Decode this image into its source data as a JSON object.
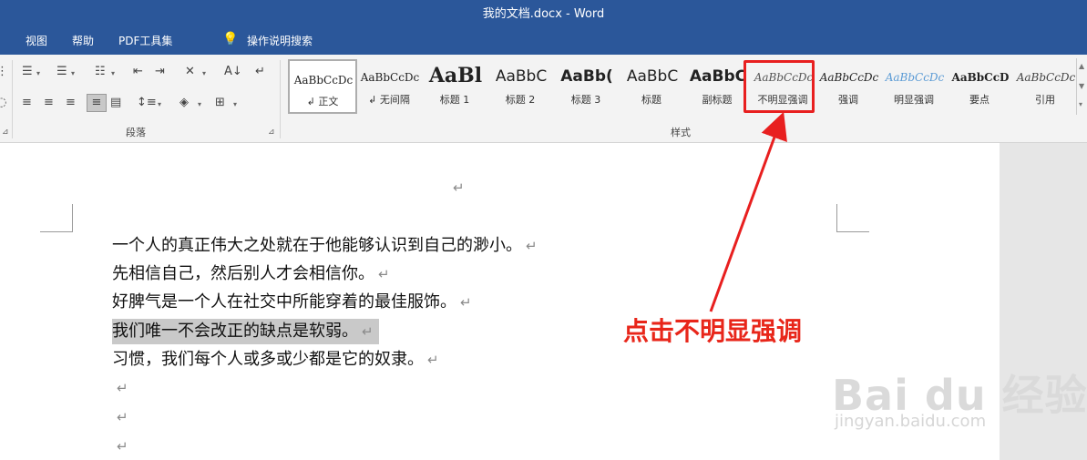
{
  "window": {
    "title": "我的文档.docx  -  Word"
  },
  "menu": {
    "items": [
      "视图",
      "帮助",
      "PDF工具集"
    ],
    "tell_me": "操作说明搜索"
  },
  "ribbon": {
    "paragraph_group_label": "段落",
    "styles_group_label": "样式",
    "styles": [
      {
        "sample": "AaBbCcDc",
        "name": "↲ 正文"
      },
      {
        "sample": "AaBbCcDc",
        "name": "↲ 无间隔"
      },
      {
        "sample": "AaBl",
        "name": "标题 1"
      },
      {
        "sample": "AaBbC",
        "name": "标题 2"
      },
      {
        "sample": "AaBb(",
        "name": "标题 3"
      },
      {
        "sample": "AaBbC",
        "name": "标题"
      },
      {
        "sample": "AaBbC",
        "name": "副标题"
      },
      {
        "sample": "AaBbCcDc",
        "name": "不明显强调"
      },
      {
        "sample": "AaBbCcDc",
        "name": "强调"
      },
      {
        "sample": "AaBbCcDc",
        "name": "明显强调"
      },
      {
        "sample": "AaBbCcD",
        "name": "要点"
      },
      {
        "sample": "AaBbCcDc",
        "name": "引用"
      }
    ],
    "selected_style_index": 0
  },
  "document": {
    "paragraph_mark": "↵",
    "lines": [
      "一个人的真正伟大之处就在于他能够认识到自己的渺小。",
      "先相信自己，然后别人才会相信你。",
      "好脾气是一个人在社交中所能穿着的最佳服饰。",
      "我们唯一不会改正的缺点是软弱。",
      "习惯，我们每个人或多或少都是它的奴隶。"
    ],
    "highlighted_line_index": 3
  },
  "annotation": {
    "text": "点击不明显强调",
    "color": "#e8261a"
  },
  "watermark": {
    "logo": "Bai du 经验",
    "url": "jingyan.baidu.com"
  },
  "colors": {
    "title_bar": "#2b579a",
    "ribbon_bg": "#f3f3f3",
    "highlight": "#c9c9c9",
    "annotation": "#e81f1f"
  }
}
